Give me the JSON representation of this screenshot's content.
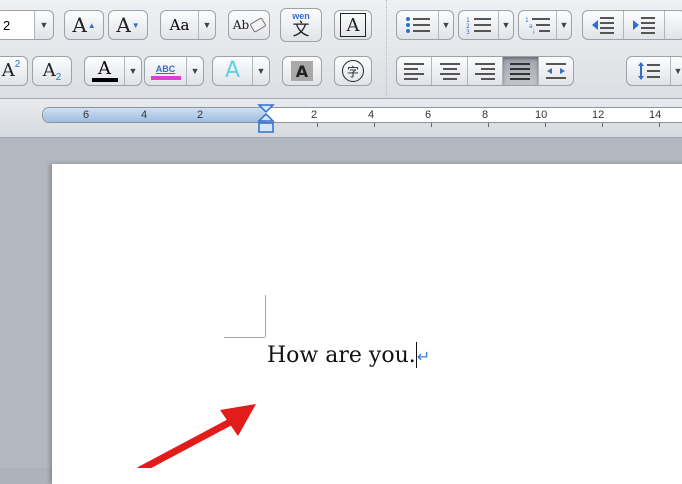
{
  "ribbon": {
    "font_size_value": "2",
    "grow_font_label": "A",
    "shrink_font_label": "A",
    "change_case_label": "Aa",
    "clear_format_label": "Ab",
    "phonetic_top": "wen",
    "phonetic_bottom": "文",
    "char_border_label": "A",
    "superscript_label": "A",
    "superscript_sup": "2",
    "subscript_label": "A",
    "subscript_sub": "2",
    "font_color_label": "A",
    "font_color": "#000000",
    "highlight_label": "ABC",
    "highlight_color": "#e33ad6",
    "text_effects_label": "A",
    "text_effects_color": "#59d4e4",
    "char_shading_label": "A",
    "enclose_char_label": "字"
  },
  "ruler": {
    "labels": [
      "6",
      "4",
      "2",
      "2",
      "4",
      "6",
      "8",
      "10",
      "12",
      "14"
    ]
  },
  "document": {
    "body_text": "How are you.",
    "paragraph_mark": "↵"
  },
  "annotation": {
    "arrow_color": "#e21b1b"
  }
}
